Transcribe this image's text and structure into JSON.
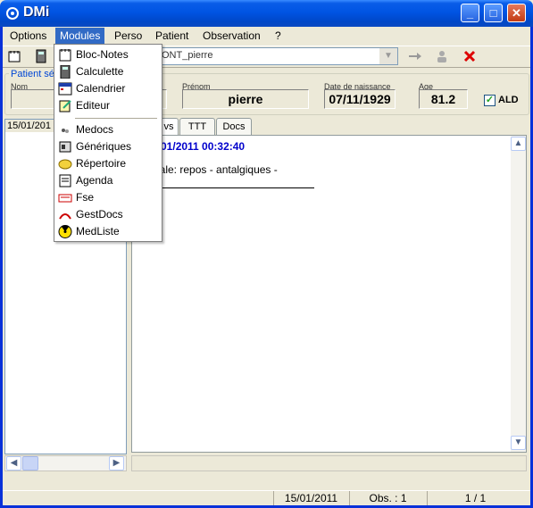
{
  "window": {
    "title": "DMi",
    "controls": {
      "minimize": "_",
      "maximize": "□",
      "close": "✕"
    }
  },
  "menubar": {
    "items": [
      "Options",
      "Modules",
      "Perso",
      "Patient",
      "Observation",
      "?"
    ]
  },
  "toolbar": {
    "patient_combo_value": "ONT_pierre"
  },
  "patient": {
    "group_label": "Patient sél",
    "nom_label": "Nom",
    "prenom_label": "Prénom",
    "prenom_value": "pierre",
    "dob_label": "Date de naissance",
    "dob_value": "07/11/1929",
    "age_label": "Age",
    "age_value": "81.2",
    "ald_label": "ALD",
    "ald_checked": true
  },
  "left_panel": {
    "items": [
      "15/01/201"
    ]
  },
  "tabs": [
    "vs",
    "TTT",
    "Docs"
  ],
  "observation": {
    "header": ": 15/01/2011 00:32:40",
    "text": "e virale: repos - antalgiques -"
  },
  "statusbar": {
    "date": "15/01/2011",
    "obs": "Obs. : 1",
    "page": "1 / 1"
  },
  "modules_menu": {
    "items": [
      {
        "label": "Bloc-Notes",
        "icon": "notepad-icon"
      },
      {
        "label": "Calculette",
        "icon": "calculator-icon"
      },
      {
        "label": "Calendrier",
        "icon": "calendar-icon"
      },
      {
        "label": "Editeur",
        "icon": "editor-icon"
      },
      {
        "label": "Medocs",
        "icon": "pills-icon"
      },
      {
        "label": "Génériques",
        "icon": "generics-icon"
      },
      {
        "label": "Répertoire",
        "icon": "directory-icon"
      },
      {
        "label": "Agenda",
        "icon": "agenda-icon"
      },
      {
        "label": "Fse",
        "icon": "fse-icon"
      },
      {
        "label": "GestDocs",
        "icon": "gestdocs-icon"
      },
      {
        "label": "MedListe",
        "icon": "radiation-icon"
      }
    ]
  }
}
